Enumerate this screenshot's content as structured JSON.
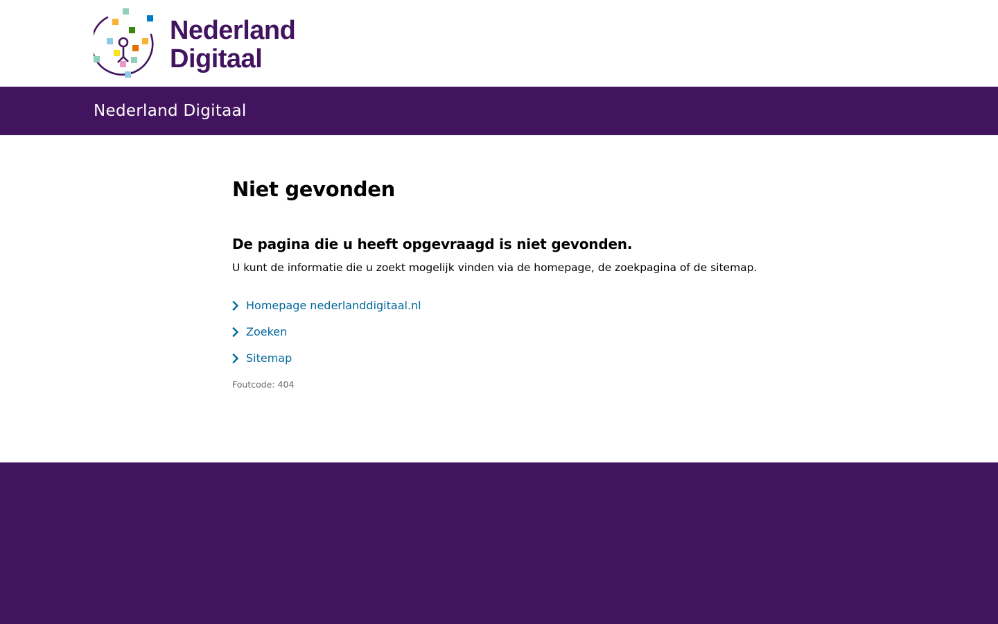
{
  "header": {
    "logo": {
      "line1": "Nederland",
      "line2": "Digitaal"
    },
    "site_title": "Nederland Digitaal"
  },
  "main": {
    "title": "Niet gevonden",
    "subheading": "De pagina die u heeft opgevraagd is niet gevonden.",
    "intro": "U kunt de informatie die u zoekt mogelijk vinden via de homepage, de zoekpagina of de sitemap.",
    "links": [
      {
        "label": "Homepage nederlanddigitaal.nl",
        "icon": "chevron-right-icon"
      },
      {
        "label": "Zoeken",
        "icon": "chevron-right-icon"
      },
      {
        "label": "Sitemap",
        "icon": "chevron-right-icon"
      }
    ],
    "error_code": "Foutcode: 404"
  },
  "colors": {
    "brand_purple": "#42145f",
    "link_blue": "#01689b",
    "muted_gray": "#696969",
    "background": "#ffffff"
  }
}
